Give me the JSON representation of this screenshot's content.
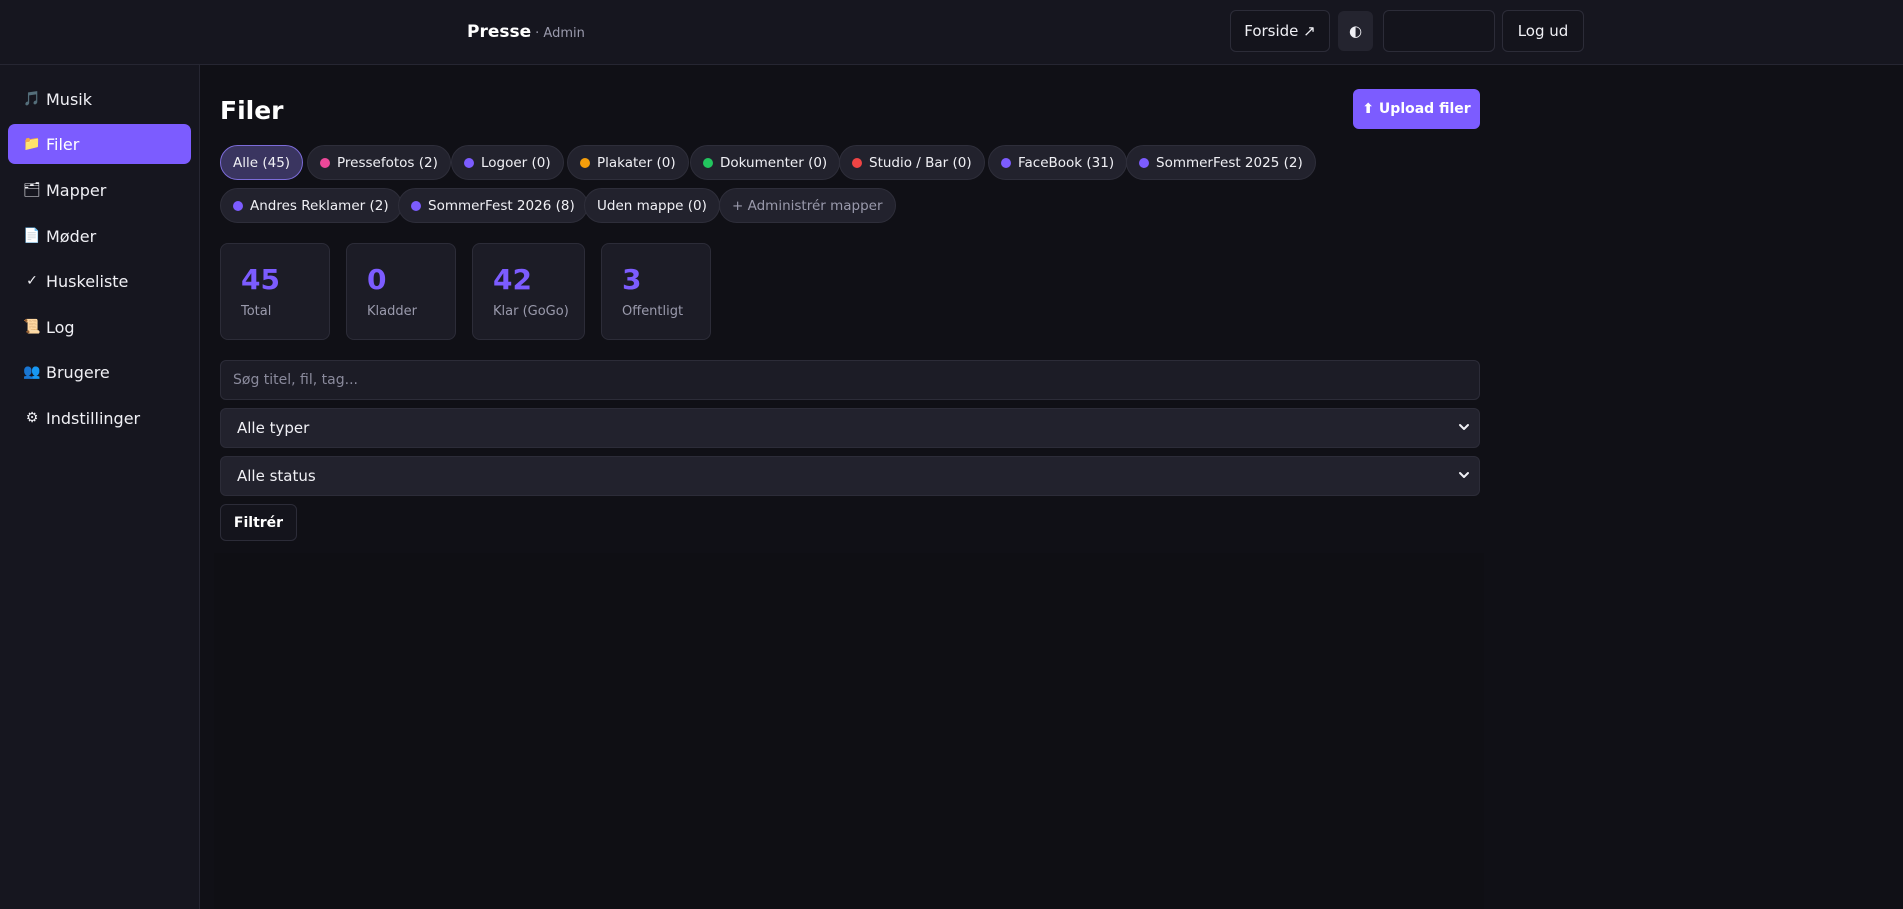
{
  "header": {
    "brand": "Presse",
    "brand_sub": "· Admin",
    "forside_label": "Forside ↗",
    "theme_icon": "◐",
    "logout_label": "Log ud"
  },
  "sidebar": {
    "items": [
      {
        "icon": "🎵",
        "label": "Musik"
      },
      {
        "icon": "📁",
        "label": "Filer"
      },
      {
        "icon": "🗂",
        "label": "Mapper"
      },
      {
        "icon": "📄",
        "label": "Møder"
      },
      {
        "icon": "✓",
        "label": "Huskeliste"
      },
      {
        "icon": "📜",
        "label": "Log"
      },
      {
        "icon": "👥",
        "label": "Brugere"
      },
      {
        "icon": "⚙",
        "label": "Indstillinger"
      }
    ],
    "active_index": 1
  },
  "main": {
    "title": "Filer",
    "upload_label": "⬆ Upload filer",
    "folders": [
      {
        "label": "Alle (45)",
        "color": null
      },
      {
        "label": "Pressefotos (2)",
        "color": "#ec4899"
      },
      {
        "label": "Logoer (0)",
        "color": "#7c5cff"
      },
      {
        "label": "Plakater (0)",
        "color": "#f59e0b"
      },
      {
        "label": "Dokumenter (0)",
        "color": "#22c55e"
      },
      {
        "label": "Studio / Bar (0)",
        "color": "#ef4444"
      },
      {
        "label": "FaceBook (31)",
        "color": "#7c5cff"
      },
      {
        "label": "SommerFest 2025 (2)",
        "color": "#7c5cff"
      },
      {
        "label": "Andres Reklamer (2)",
        "color": "#7c5cff"
      },
      {
        "label": "SommerFest 2026 (8)",
        "color": "#7c5cff"
      },
      {
        "label": "Uden mappe (0)",
        "color": null
      },
      {
        "label": "+ Administrér mapper",
        "color": null
      }
    ],
    "stats": [
      {
        "value": "45",
        "label": "Total"
      },
      {
        "value": "0",
        "label": "Kladder"
      },
      {
        "value": "42",
        "label": "Klar (GoGo)"
      },
      {
        "value": "3",
        "label": "Offentligt"
      }
    ],
    "search_placeholder": "Søg titel, fil, tag...",
    "type_select": "Alle typer",
    "status_select": "Alle status",
    "filter_label": "Filtrér"
  },
  "colors": {
    "accent": "#7c5cff",
    "background": "#101016",
    "panel": "#16161f"
  }
}
